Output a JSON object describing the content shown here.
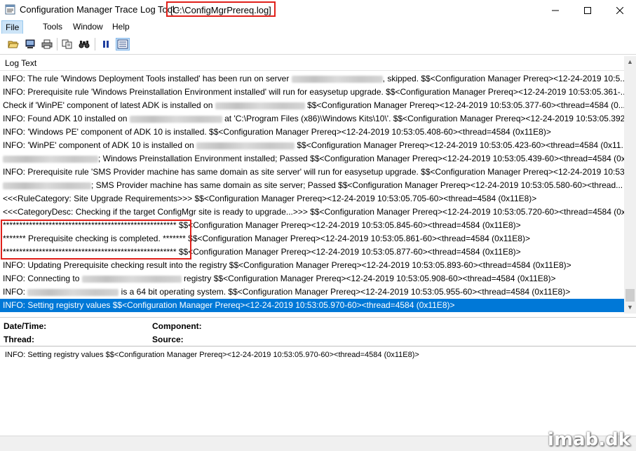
{
  "window": {
    "title": "Configuration Manager Trace Log Tool -",
    "file_path": "[C:\\ConfigMgrPrereq.log]",
    "controls": [
      "minimize",
      "maximize",
      "close"
    ]
  },
  "menu": {
    "items": [
      {
        "label": "File",
        "active": true
      },
      {
        "label": "Tools",
        "active": false
      },
      {
        "label": "Window",
        "active": false
      },
      {
        "label": "Help",
        "active": false
      }
    ]
  },
  "toolbar": {
    "buttons": [
      "open-icon",
      "print-preview-icon",
      "print-icon",
      "copy-icon",
      "find-icon",
      "pause-icon",
      "highlight-icon"
    ],
    "pressed": "highlight-icon"
  },
  "log_list": {
    "header": "Log Text",
    "rows": [
      {
        "pre": "INFO: The rule 'Windows Deployment Tools installed' has been run on server ",
        "redacted": 130,
        "post": ", skipped.  $$<Configuration Manager Prereq><12-24-2019 10:5..."
      },
      {
        "pre": "INFO: Prerequisite rule 'Windows Preinstallation Environment installed' will run for easysetup upgrade.  $$<Configuration Manager Prereq><12-24-2019 10:53:05.361-...",
        "redacted": 0,
        "post": ""
      },
      {
        "pre": "Check if 'WinPE' component of latest ADK is installed on ",
        "redacted": 128,
        "post": "  $$<Configuration Manager Prereq><12-24-2019 10:53:05.377-60><thread=4584 (0..."
      },
      {
        "pre": "INFO: Found ADK 10 installed on ",
        "redacted": 132,
        "post": " at 'C:\\Program Files (x86)\\Windows Kits\\10\\'.  $$<Configuration Manager Prereq><12-24-2019 10:53:05.392-..."
      },
      {
        "pre": "INFO: 'Windows PE' component of ADK 10 is installed.  $$<Configuration Manager Prereq><12-24-2019 10:53:05.408-60><thread=4584 (0x11E8)>",
        "redacted": 0,
        "post": ""
      },
      {
        "pre": "INFO: 'WinPE' component of ADK 10 is installed on ",
        "redacted": 140,
        "post": "  $$<Configuration Manager Prereq><12-24-2019 10:53:05.423-60><thread=4584 (0x11..."
      },
      {
        "pre": "",
        "redacted": 136,
        "post": ";    Windows Preinstallation Environment installed;    Passed  $$<Configuration Manager Prereq><12-24-2019 10:53:05.439-60><thread=4584 (0x11E8)>"
      },
      {
        "pre": "INFO: Prerequisite rule 'SMS Provider machine has same domain as site server' will run for easysetup upgrade.  $$<Configuration Manager Prereq><12-24-2019 10:53:...",
        "redacted": 0,
        "post": ""
      },
      {
        "pre": "",
        "redacted": 126,
        "post": ";    SMS Provider machine has same domain as site server;    Passed  $$<Configuration Manager Prereq><12-24-2019 10:53:05.580-60><thread..."
      },
      {
        "pre": "<<<RuleCategory: Site Upgrade Requirements>>>  $$<Configuration Manager Prereq><12-24-2019 10:53:05.705-60><thread=4584 (0x11E8)>",
        "redacted": 0,
        "post": ""
      },
      {
        "pre": "<<<CategoryDesc: Checking if the target ConfigMgr site is ready to upgrade...>>>  $$<Configuration Manager Prereq><12-24-2019 10:53:05.720-60><thread=4584 (0x11E8)>",
        "redacted": 0,
        "post": ""
      },
      {
        "pre": "***************************************************** $$<Configuration Manager Prereq><12-24-2019 10:53:05.845-60><thread=4584 (0x11E8)>",
        "redacted": 0,
        "post": ""
      },
      {
        "pre": "******* Prerequisite checking is completed. *******  $$<Configuration Manager Prereq><12-24-2019 10:53:05.861-60><thread=4584 (0x11E8)>",
        "redacted": 0,
        "post": ""
      },
      {
        "pre": "***************************************************** $$<Configuration Manager Prereq><12-24-2019 10:53:05.877-60><thread=4584 (0x11E8)>",
        "redacted": 0,
        "post": ""
      },
      {
        "pre": "INFO: Updating Prerequisite checking result into the registry  $$<Configuration Manager Prereq><12-24-2019 10:53:05.893-60><thread=4584 (0x11E8)>",
        "redacted": 0,
        "post": ""
      },
      {
        "pre": "INFO: Connecting to ",
        "redacted": 142,
        "post": " registry  $$<Configuration Manager Prereq><12-24-2019 10:53:05.908-60><thread=4584 (0x11E8)>"
      },
      {
        "pre": "INFO: ",
        "redacted": 130,
        "post": " is a 64 bit operating system.  $$<Configuration Manager Prereq><12-24-2019 10:53:05.955-60><thread=4584 (0x11E8)>"
      },
      {
        "pre": "INFO: Setting registry values  $$<Configuration Manager Prereq><12-24-2019 10:53:05.970-60><thread=4584 (0x11E8)>",
        "redacted": 0,
        "post": "",
        "selected": true
      }
    ]
  },
  "details": {
    "datetime_label": "Date/Time:",
    "component_label": "Component:",
    "thread_label": "Thread:",
    "source_label": "Source:",
    "message": "INFO: Setting registry values  $$<Configuration Manager Prereq><12-24-2019 10:53:05.970-60><thread=4584 (0x11E8)>"
  },
  "watermark": "imab.dk",
  "colors": {
    "selection": "#0078d7",
    "annotation_red": "#e0201a"
  }
}
